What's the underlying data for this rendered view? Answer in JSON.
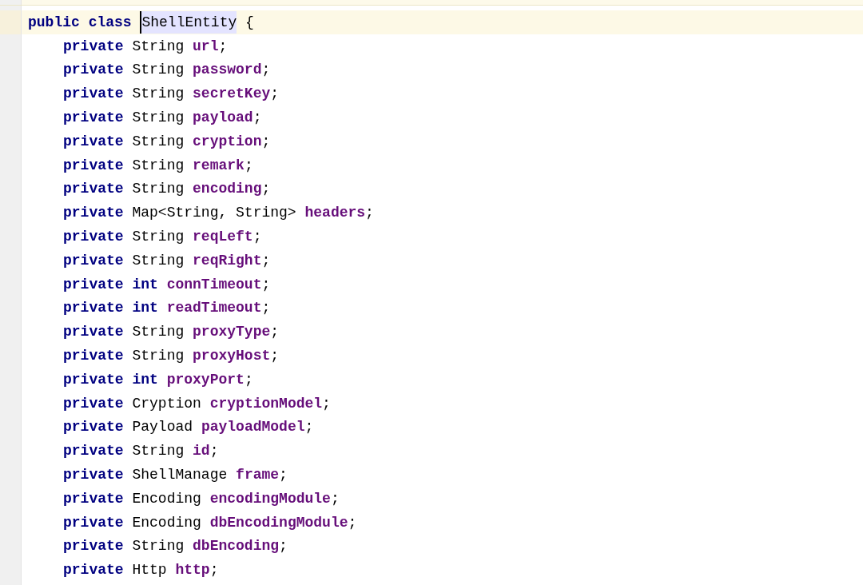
{
  "editor": {
    "lines": [
      {
        "current": true,
        "tokens": [
          {
            "kind": "keyword",
            "text": "public"
          },
          {
            "kind": "keyword",
            "text": "class"
          },
          {
            "kind": "class-name",
            "text": "ShellEntity",
            "highlighted": true,
            "caret": true
          },
          {
            "kind": "plain",
            "text": "{"
          }
        ],
        "children": [
          {
            "tokens": [
              {
                "kind": "keyword",
                "text": "private"
              },
              {
                "kind": "plain",
                "text": "String"
              },
              {
                "kind": "field",
                "text": "url"
              },
              {
                "kind": "semicolon",
                "text": ";"
              }
            ]
          },
          {
            "tokens": [
              {
                "kind": "keyword",
                "text": "private"
              },
              {
                "kind": "plain",
                "text": "String"
              },
              {
                "kind": "field",
                "text": "password"
              },
              {
                "kind": "semicolon",
                "text": ";"
              }
            ]
          },
          {
            "tokens": [
              {
                "kind": "keyword",
                "text": "private"
              },
              {
                "kind": "plain",
                "text": "String"
              },
              {
                "kind": "field",
                "text": "secretKey"
              },
              {
                "kind": "semicolon",
                "text": ";"
              }
            ]
          },
          {
            "tokens": [
              {
                "kind": "keyword",
                "text": "private"
              },
              {
                "kind": "plain",
                "text": "String"
              },
              {
                "kind": "field",
                "text": "payload"
              },
              {
                "kind": "semicolon",
                "text": ";"
              }
            ]
          },
          {
            "tokens": [
              {
                "kind": "keyword",
                "text": "private"
              },
              {
                "kind": "plain",
                "text": "String"
              },
              {
                "kind": "field",
                "text": "cryption"
              },
              {
                "kind": "semicolon",
                "text": ";"
              }
            ]
          },
          {
            "tokens": [
              {
                "kind": "keyword",
                "text": "private"
              },
              {
                "kind": "plain",
                "text": "String"
              },
              {
                "kind": "field",
                "text": "remark"
              },
              {
                "kind": "semicolon",
                "text": ";"
              }
            ]
          },
          {
            "tokens": [
              {
                "kind": "keyword",
                "text": "private"
              },
              {
                "kind": "plain",
                "text": "String"
              },
              {
                "kind": "field",
                "text": "encoding"
              },
              {
                "kind": "semicolon",
                "text": ";"
              }
            ]
          },
          {
            "tokens": [
              {
                "kind": "keyword",
                "text": "private"
              },
              {
                "kind": "plain",
                "text": "Map<String, String>"
              },
              {
                "kind": "field",
                "text": "headers"
              },
              {
                "kind": "semicolon",
                "text": ";"
              }
            ]
          },
          {
            "tokens": [
              {
                "kind": "keyword",
                "text": "private"
              },
              {
                "kind": "plain",
                "text": "String"
              },
              {
                "kind": "field",
                "text": "reqLeft"
              },
              {
                "kind": "semicolon",
                "text": ";"
              }
            ]
          },
          {
            "tokens": [
              {
                "kind": "keyword",
                "text": "private"
              },
              {
                "kind": "plain",
                "text": "String"
              },
              {
                "kind": "field",
                "text": "reqRight"
              },
              {
                "kind": "semicolon",
                "text": ";"
              }
            ]
          },
          {
            "tokens": [
              {
                "kind": "keyword",
                "text": "private"
              },
              {
                "kind": "keyword",
                "text": "int"
              },
              {
                "kind": "field",
                "text": "connTimeout"
              },
              {
                "kind": "semicolon",
                "text": ";"
              }
            ]
          },
          {
            "tokens": [
              {
                "kind": "keyword",
                "text": "private"
              },
              {
                "kind": "keyword",
                "text": "int"
              },
              {
                "kind": "field",
                "text": "readTimeout"
              },
              {
                "kind": "semicolon",
                "text": ";"
              }
            ]
          },
          {
            "tokens": [
              {
                "kind": "keyword",
                "text": "private"
              },
              {
                "kind": "plain",
                "text": "String"
              },
              {
                "kind": "field",
                "text": "proxyType"
              },
              {
                "kind": "semicolon",
                "text": ";"
              }
            ]
          },
          {
            "tokens": [
              {
                "kind": "keyword",
                "text": "private"
              },
              {
                "kind": "plain",
                "text": "String"
              },
              {
                "kind": "field",
                "text": "proxyHost"
              },
              {
                "kind": "semicolon",
                "text": ";"
              }
            ]
          },
          {
            "tokens": [
              {
                "kind": "keyword",
                "text": "private"
              },
              {
                "kind": "keyword",
                "text": "int"
              },
              {
                "kind": "field",
                "text": "proxyPort"
              },
              {
                "kind": "semicolon",
                "text": ";"
              }
            ]
          },
          {
            "tokens": [
              {
                "kind": "keyword",
                "text": "private"
              },
              {
                "kind": "plain",
                "text": "Cryption"
              },
              {
                "kind": "field",
                "text": "cryptionModel"
              },
              {
                "kind": "semicolon",
                "text": ";"
              }
            ]
          },
          {
            "tokens": [
              {
                "kind": "keyword",
                "text": "private"
              },
              {
                "kind": "plain",
                "text": "Payload"
              },
              {
                "kind": "field",
                "text": "payloadModel"
              },
              {
                "kind": "semicolon",
                "text": ";"
              }
            ]
          },
          {
            "tokens": [
              {
                "kind": "keyword",
                "text": "private"
              },
              {
                "kind": "plain",
                "text": "String"
              },
              {
                "kind": "field",
                "text": "id"
              },
              {
                "kind": "semicolon",
                "text": ";"
              }
            ]
          },
          {
            "tokens": [
              {
                "kind": "keyword",
                "text": "private"
              },
              {
                "kind": "plain",
                "text": "ShellManage"
              },
              {
                "kind": "field",
                "text": "frame"
              },
              {
                "kind": "semicolon",
                "text": ";"
              }
            ]
          },
          {
            "tokens": [
              {
                "kind": "keyword",
                "text": "private"
              },
              {
                "kind": "plain",
                "text": "Encoding"
              },
              {
                "kind": "field",
                "text": "encodingModule"
              },
              {
                "kind": "semicolon",
                "text": ";"
              }
            ]
          },
          {
            "tokens": [
              {
                "kind": "keyword",
                "text": "private"
              },
              {
                "kind": "plain",
                "text": "Encoding"
              },
              {
                "kind": "field",
                "text": "dbEncodingModule"
              },
              {
                "kind": "semicolon",
                "text": ";"
              }
            ]
          },
          {
            "tokens": [
              {
                "kind": "keyword",
                "text": "private"
              },
              {
                "kind": "plain",
                "text": "String"
              },
              {
                "kind": "field",
                "text": "dbEncoding"
              },
              {
                "kind": "semicolon",
                "text": ";"
              }
            ]
          },
          {
            "tokens": [
              {
                "kind": "keyword",
                "text": "private"
              },
              {
                "kind": "plain",
                "text": "Http"
              },
              {
                "kind": "field",
                "text": "http"
              },
              {
                "kind": "semicolon",
                "text": ";"
              }
            ]
          }
        ]
      }
    ]
  }
}
